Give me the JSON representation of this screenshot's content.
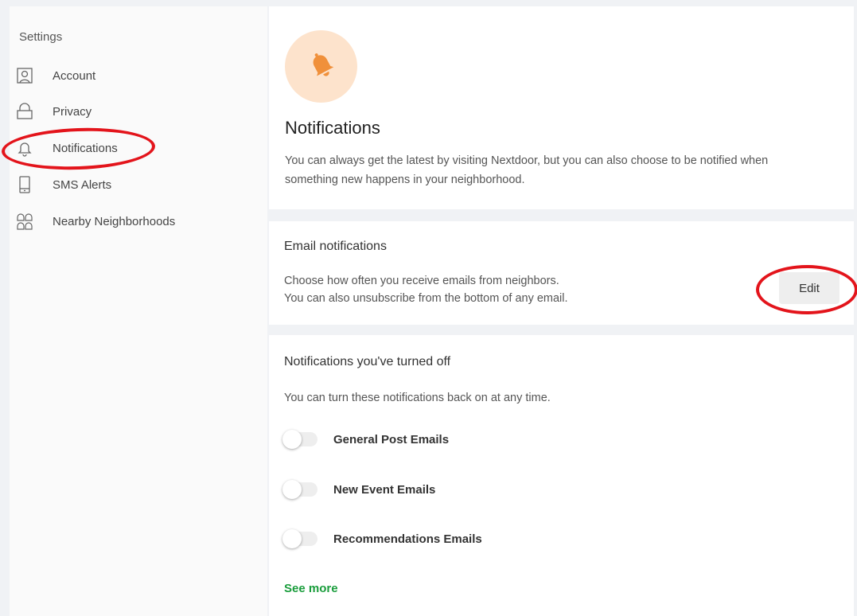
{
  "sidebar": {
    "heading": "Settings",
    "items": [
      {
        "label": "Account",
        "icon": "account-icon"
      },
      {
        "label": "Privacy",
        "icon": "lock-icon"
      },
      {
        "label": "Notifications",
        "icon": "bell-icon"
      },
      {
        "label": "SMS Alerts",
        "icon": "phone-icon"
      },
      {
        "label": "Nearby Neighborhoods",
        "icon": "neighborhoods-icon"
      }
    ]
  },
  "hero": {
    "icon": "bell-icon",
    "title": "Notifications",
    "description": "You can always get the latest by visiting Nextdoor, but you can also choose to be notified when something new happens in your neighborhood."
  },
  "email": {
    "title": "Email notifications",
    "line1": "Choose how often you receive emails from neighbors.",
    "line2": "You can also unsubscribe from the bottom of any email.",
    "edit_label": "Edit"
  },
  "turned_off": {
    "title": "Notifications you've turned off",
    "description": "You can turn these notifications back on at any time.",
    "toggles": [
      {
        "label": "General Post Emails",
        "on": false
      },
      {
        "label": "New Event Emails",
        "on": false
      },
      {
        "label": "Recommendations Emails",
        "on": false
      }
    ],
    "see_more": "See more"
  },
  "colors": {
    "accent_orange": "#f0903a",
    "hero_circle_bg": "#fde3cc",
    "link_green": "#1a9d3c",
    "annotation_red": "#e3141b"
  }
}
